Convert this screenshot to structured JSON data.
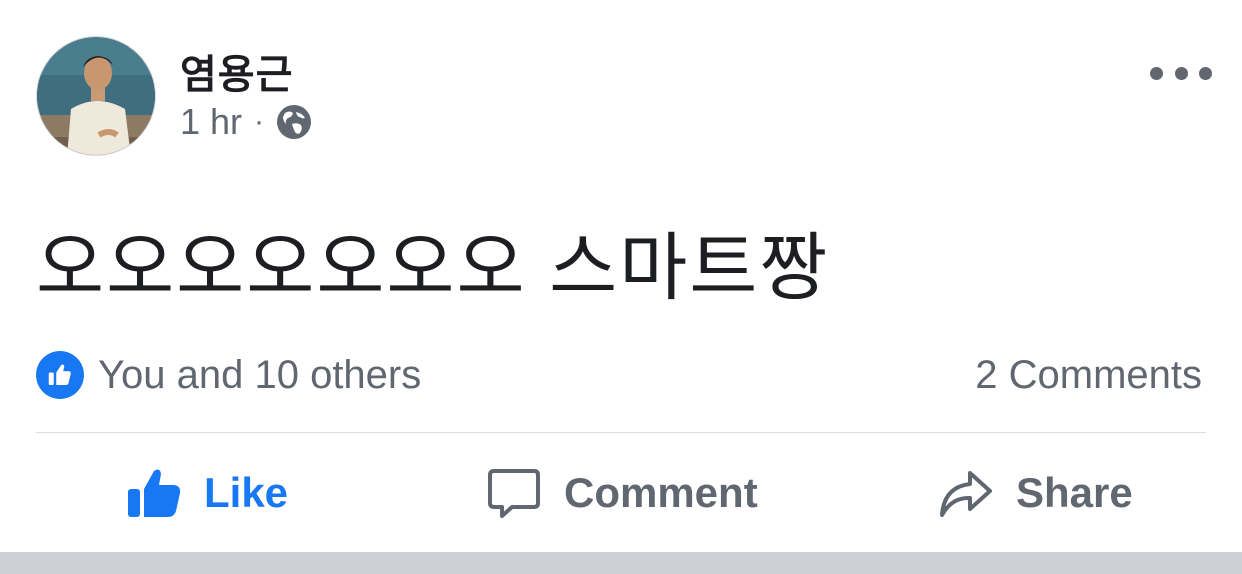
{
  "post": {
    "author": "염용근",
    "time": "1 hr",
    "separator": "·",
    "audience_icon": "globe-icon",
    "text": "오오오오오오오 스마트짱"
  },
  "reactions": {
    "summary": "You and 10 others",
    "icon": "like-badge-icon",
    "comments": "2 Comments"
  },
  "actions": {
    "like": "Like",
    "comment": "Comment",
    "share": "Share"
  },
  "colors": {
    "accent": "#1877f2",
    "secondary_text": "#606770",
    "primary_text": "#1c1e21",
    "divider": "#dadde1",
    "footer_bar": "#ccd0d5"
  }
}
